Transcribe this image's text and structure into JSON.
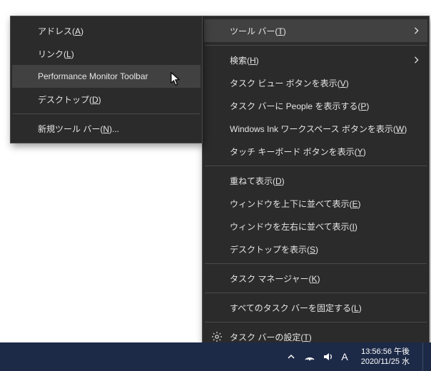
{
  "taskbar": {
    "clock_time": "13:56:56 午後",
    "clock_date": "2020/11/25 水",
    "ime_indicator": "A"
  },
  "main_menu": {
    "items": [
      {
        "label": "ツール バー(T)",
        "underline": "T",
        "submenu_arrow": true,
        "hover": true
      },
      {
        "sep": true
      },
      {
        "label": "検索(H)",
        "underline": "H",
        "submenu_arrow": true
      },
      {
        "label": "タスク ビュー ボタンを表示(V)",
        "underline": "V"
      },
      {
        "label": "タスク バーに People を表示する(P)",
        "underline": "P"
      },
      {
        "label": "Windows Ink ワークスペース ボタンを表示(W)",
        "underline": "W"
      },
      {
        "label": "タッチ キーボード ボタンを表示(Y)",
        "underline": "Y"
      },
      {
        "sep": true
      },
      {
        "label": "重ねて表示(D)",
        "underline": "D"
      },
      {
        "label": "ウィンドウを上下に並べて表示(E)",
        "underline": "E"
      },
      {
        "label": "ウィンドウを左右に並べて表示(I)",
        "underline": "I"
      },
      {
        "label": "デスクトップを表示(S)",
        "underline": "S"
      },
      {
        "sep": true
      },
      {
        "label": "タスク マネージャー(K)",
        "underline": "K"
      },
      {
        "sep": true
      },
      {
        "label": "すべてのタスク バーを固定する(L)",
        "underline": "L"
      },
      {
        "sep": true
      },
      {
        "label": "タスク バーの設定(T)",
        "underline": "T",
        "lead_icon": "gear-icon"
      }
    ]
  },
  "sub_menu": {
    "items": [
      {
        "label": "アドレス(A)",
        "underline": "A"
      },
      {
        "label": "リンク(L)",
        "underline": "L"
      },
      {
        "label": "Performance Monitor Toolbar",
        "hover": true
      },
      {
        "label": "デスクトップ(D)",
        "underline": "D"
      },
      {
        "sep": true
      },
      {
        "label": "新規ツール バー(N)...",
        "underline": "N"
      }
    ]
  }
}
